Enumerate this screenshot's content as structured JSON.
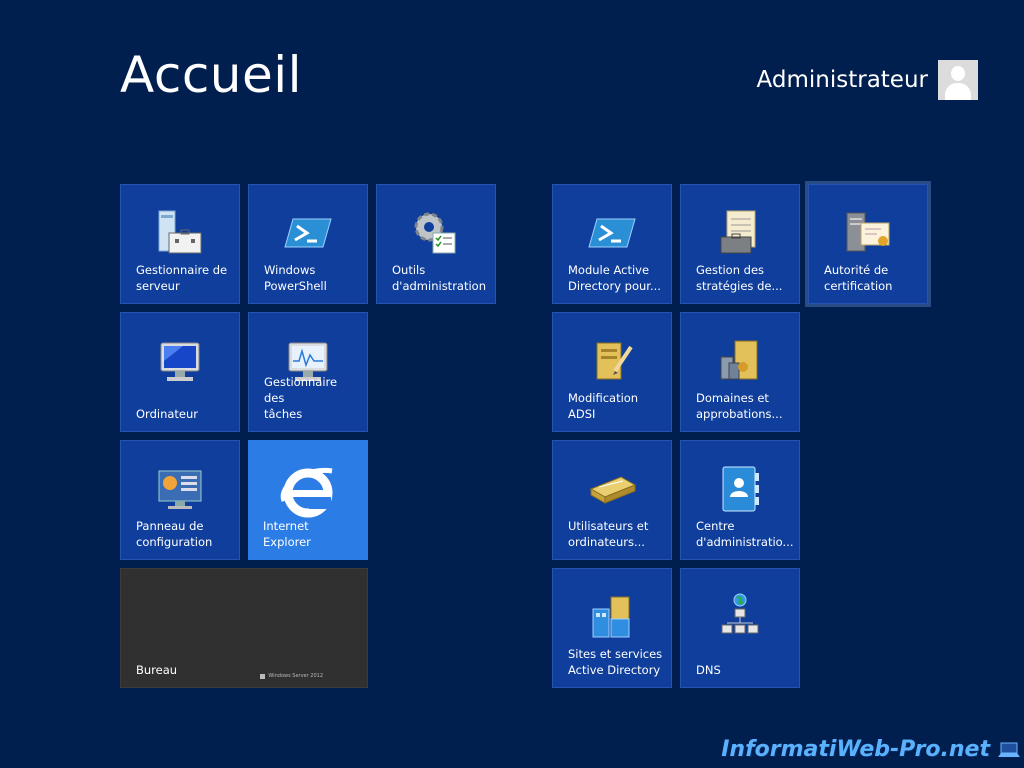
{
  "header": {
    "title": "Accueil",
    "user_name": "Administrateur"
  },
  "tiles": {
    "server_manager": "Gestionnaire de\nserveur",
    "powershell": "Windows\nPowerShell",
    "admin_tools": "Outils\nd'administration",
    "computer": "Ordinateur",
    "task_manager": "Gestionnaire des\ntâches",
    "control_panel": "Panneau de\nconfiguration",
    "internet_explorer": "Internet Explorer",
    "desktop": "Bureau",
    "desktop_brand": "Windows Server 2012",
    "ad_module": "Module Active\nDirectory pour...",
    "gpo": "Gestion des\nstratégies de...",
    "cert_authority": "Autorité de\ncertification",
    "adsi": "Modification\nADSI",
    "domains_trusts": "Domaines et\napprobations...",
    "users_computers": "Utilisateurs et\nordinateurs...",
    "admin_center": "Centre\nd'administratio...",
    "sites_services": "Sites et services\nActive Directory",
    "dns": "DNS"
  },
  "watermark": "InformatiWeb-Pro.net",
  "colors": {
    "background": "#001e4e",
    "tile": "#0f3e9c",
    "ie_tile": "#2c7ce6",
    "desktop_tile": "#303030"
  }
}
